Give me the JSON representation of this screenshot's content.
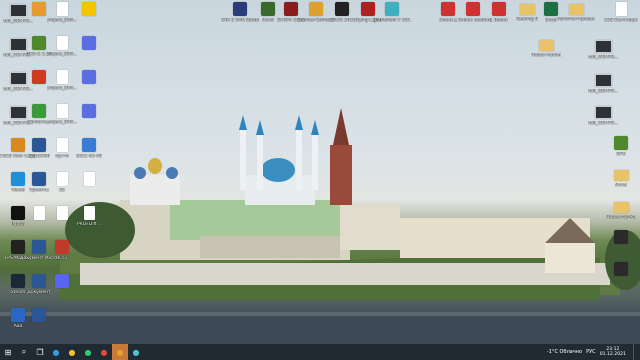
{
  "desktop": {
    "icons_left": [
      {
        "label": "Itall_OEM78...",
        "type": "pc",
        "color": "#3a6ea5"
      },
      {
        "label": "Itall_OEM78...",
        "type": "pc",
        "color": "#3a6ea5"
      },
      {
        "label": "Itall_OEM78...",
        "type": "pc",
        "color": "#3a6ea5"
      },
      {
        "label": "Itall_OEM78...",
        "type": "pc",
        "color": "#3a6ea5"
      },
      {
        "label": "CODE Kiev Copy Tool",
        "type": "app",
        "color": "#d98a1e"
      },
      {
        "label": "Visual",
        "type": "app",
        "color": "#1e8fd9"
      },
      {
        "label": "Panda",
        "type": "app",
        "color": "#111111"
      },
      {
        "label": "FPS Monitor",
        "type": "app",
        "color": "#222222"
      },
      {
        "label": "Steam",
        "type": "app",
        "color": "#1b2838"
      },
      {
        "label": "Aaa",
        "type": "app",
        "color": "#2b68c4"
      }
    ],
    "icons_col2": [
      {
        "label": "",
        "type": "app",
        "color": "#e89b2c"
      },
      {
        "label": "GPU-Z 2.20",
        "type": "app",
        "color": "#4e8a2c"
      },
      {
        "label": "",
        "type": "app",
        "color": "#d03a1e"
      },
      {
        "label": "Windows...",
        "type": "app",
        "color": "#3a9a3a"
      },
      {
        "label": "Kiski2506",
        "type": "word",
        "color": "#2b5797"
      },
      {
        "label": "Проекты",
        "type": "word",
        "color": "#2b5797"
      },
      {
        "label": "",
        "type": "file",
        "color": "#ffffff"
      },
      {
        "label": "Документ Microsoft...",
        "type": "word",
        "color": "#2b5797"
      },
      {
        "label": "Документ",
        "type": "word",
        "color": "#2b5797"
      },
      {
        "label": "",
        "type": "word",
        "color": "#2b5797"
      }
    ],
    "icons_col3": [
      {
        "label": "project_B06...",
        "type": "file",
        "color": "#ffffff"
      },
      {
        "label": "project_B06...",
        "type": "file",
        "color": "#ffffff"
      },
      {
        "label": "project_B06...",
        "type": "file",
        "color": "#ffffff"
      },
      {
        "label": "project_B06...",
        "type": "file",
        "color": "#ffffff"
      },
      {
        "label": "пусто",
        "type": "file",
        "color": "#ffffff"
      },
      {
        "label": "3D",
        "type": "file",
        "color": "#ffffff"
      },
      {
        "label": "",
        "type": "file",
        "color": "#ffffff"
      },
      {
        "label": "OCCT",
        "type": "app",
        "color": "#c0392b"
      },
      {
        "label": "",
        "type": "app",
        "color": "#5865f2"
      }
    ],
    "icons_col4": [
      {
        "label": "",
        "type": "app",
        "color": "#f2c500"
      },
      {
        "label": "",
        "type": "app",
        "color": "#5b6ee1"
      },
      {
        "label": "",
        "type": "app",
        "color": "#5b6ee1"
      },
      {
        "label": "",
        "type": "app",
        "color": "#5b6ee1"
      },
      {
        "label": "2021-02-09",
        "type": "app",
        "color": "#3a7bd5"
      },
      {
        "label": "",
        "type": "file",
        "color": "#ffffff"
      },
      {
        "label": "PROFDiff...",
        "type": "file",
        "color": "#ffffff"
      }
    ],
    "icons_top": [
      {
        "label": "GTA 5 SAN Battlefront 2",
        "type": "app",
        "color": "#2a3d7a"
      },
      {
        "label": "Nuvel",
        "type": "app",
        "color": "#3a6a2a"
      },
      {
        "label": "DOOM 2016",
        "type": "app",
        "color": "#8a1e1e"
      },
      {
        "label": "Counter-Strike Global Off.",
        "type": "app",
        "color": "#e0a030"
      },
      {
        "label": "CS:GO 2019",
        "type": "app",
        "color": "#222222"
      },
      {
        "label": "Dying Light",
        "type": "app",
        "color": "#b02020"
      },
      {
        "label": "Battlefield V 2017",
        "type": "app",
        "color": "#3fb0c0"
      },
      {
        "label": "Бланк...",
        "type": "app",
        "color": "#d03030"
      },
      {
        "label": "1 Бланк (вебинар)",
        "type": "app",
        "color": "#d03030"
      },
      {
        "label": "1 Бланк",
        "type": "app",
        "color": "#d03030"
      },
      {
        "label": "Reading B",
        "type": "folder",
        "color": "#e8c36a"
      },
      {
        "label": "Excel",
        "type": "app",
        "color": "#1d7044"
      },
      {
        "label": "Автотестирование",
        "type": "folder",
        "color": "#e8c36a"
      },
      {
        "label": "CSS Бенчмарк",
        "type": "file",
        "color": "#ffffff"
      }
    ],
    "icons_right": [
      {
        "label": "Новая папка",
        "type": "folder",
        "color": "#e8c36a"
      },
      {
        "label": "Itall_OEM78...",
        "type": "pc",
        "color": "#3a6ea5"
      },
      {
        "label": "Itall_OEM78...",
        "type": "pc",
        "color": "#3a6ea5"
      },
      {
        "label": "Itall_OEM78...",
        "type": "pc",
        "color": "#3a6ea5"
      },
      {
        "label": "GPU",
        "type": "app",
        "color": "#4e8a2c"
      },
      {
        "label": "Nuvel",
        "type": "folder",
        "color": "#e8c36a"
      },
      {
        "label": "Новая папка",
        "type": "folder",
        "color": "#e8c36a"
      },
      {
        "label": "",
        "type": "app",
        "color": "#2a2a2a"
      },
      {
        "label": "",
        "type": "app",
        "color": "#2a2a2a"
      }
    ]
  },
  "taskbar": {
    "start_glyph": "⊞",
    "search_glyph": "⌕",
    "taskview_glyph": "❐",
    "apps": [
      {
        "glyph": "●",
        "color": "#3a9ae0"
      },
      {
        "glyph": "●",
        "color": "#f0c030"
      },
      {
        "glyph": "●",
        "color": "#2ecc71"
      },
      {
        "glyph": "●",
        "color": "#e0463a"
      },
      {
        "glyph": "●",
        "color": "#e8a030"
      },
      {
        "glyph": "●",
        "color": "#4ec0d0"
      }
    ],
    "weather": "-1°C  Облачно",
    "language": "РУС",
    "time": "23:12",
    "date": "01.12.2021"
  }
}
